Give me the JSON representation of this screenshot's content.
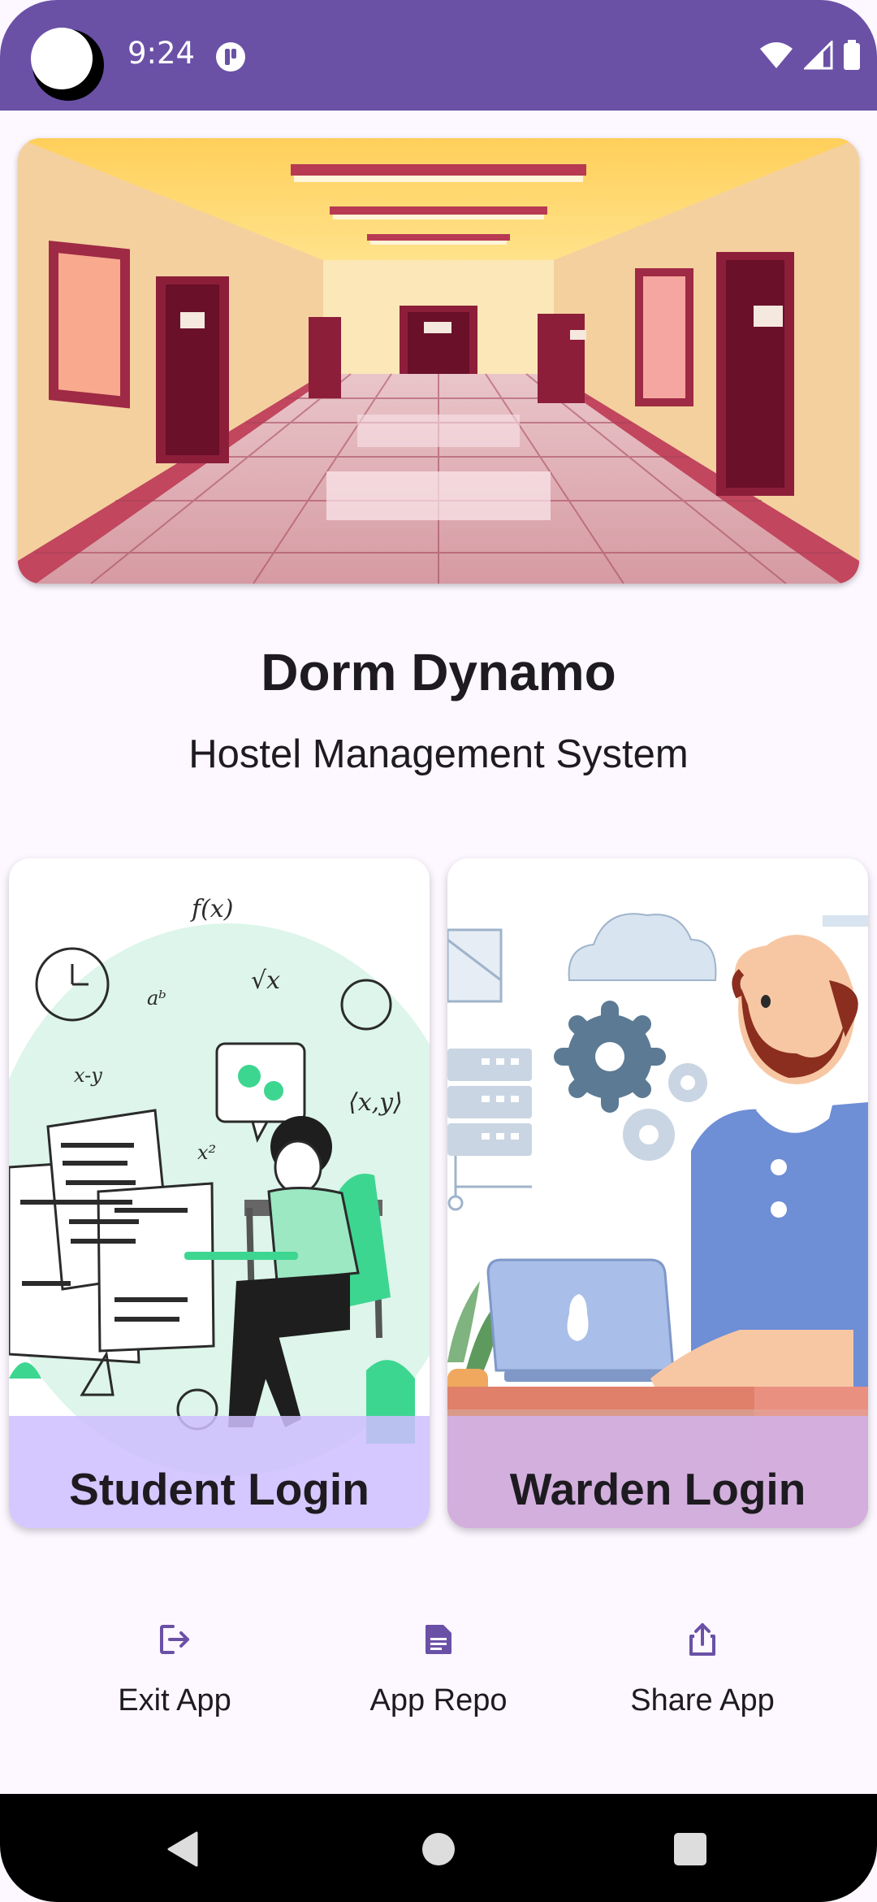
{
  "status_bar": {
    "time": "9:24",
    "color": "#6A51A6"
  },
  "hero": {
    "illustration": "hostel-corridor-illustration"
  },
  "app": {
    "title": "Dorm Dynamo",
    "subtitle": "Hostel Management System"
  },
  "login_cards": {
    "student": {
      "label": "Student Login",
      "illustration": "student-studying-illustration"
    },
    "warden": {
      "label": "Warden Login",
      "illustration": "warden-at-laptop-illustration"
    }
  },
  "actions": {
    "exit_label": "Exit App",
    "repo_label": "App Repo",
    "share_label": "Share App",
    "icon_color": "#6A51A6"
  },
  "navigation": {
    "back_icon": "back-triangle-icon",
    "home_icon": "home-circle-icon",
    "recent_icon": "recent-square-icon"
  }
}
